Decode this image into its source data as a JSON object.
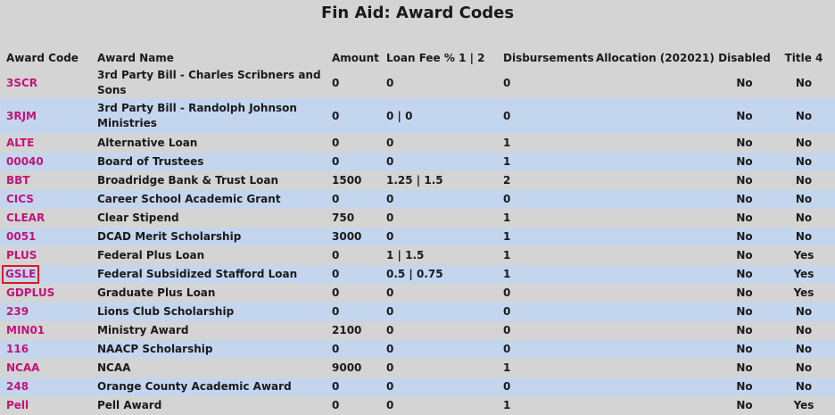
{
  "page": {
    "title": "Fin Aid: Award Codes"
  },
  "table": {
    "headers": [
      "Award Code",
      "Award Name",
      "Amount",
      "Loan Fee % 1 | 2",
      "Disbursements",
      "Allocation (202021)",
      "Disabled",
      "Title 4"
    ],
    "rows": [
      {
        "code": "3SCR",
        "name": "3rd Party Bill - Charles Scribners and Sons",
        "amount": "0",
        "fee": "0",
        "disb": "0",
        "alloc": "",
        "disabled": "No",
        "title4": "No"
      },
      {
        "code": "3RJM",
        "name": "3rd Party Bill - Randolph Johnson Ministries",
        "amount": "0",
        "fee": "0 | 0",
        "disb": "0",
        "alloc": "",
        "disabled": "No",
        "title4": "No"
      },
      {
        "code": "ALTE",
        "name": "Alternative Loan",
        "amount": "0",
        "fee": "0",
        "disb": "1",
        "alloc": "",
        "disabled": "No",
        "title4": "No"
      },
      {
        "code": "00040",
        "name": "Board of Trustees",
        "amount": "0",
        "fee": "0",
        "disb": "1",
        "alloc": "",
        "disabled": "No",
        "title4": "No"
      },
      {
        "code": "BBT",
        "name": "Broadridge Bank & Trust Loan",
        "amount": "1500",
        "fee": "1.25 | 1.5",
        "disb": "2",
        "alloc": "",
        "disabled": "No",
        "title4": "No"
      },
      {
        "code": "CICS",
        "name": "Career School Academic Grant",
        "amount": "0",
        "fee": "0",
        "disb": "0",
        "alloc": "",
        "disabled": "No",
        "title4": "No"
      },
      {
        "code": "CLEAR",
        "name": "Clear Stipend",
        "amount": "750",
        "fee": "0",
        "disb": "1",
        "alloc": "",
        "disabled": "No",
        "title4": "No"
      },
      {
        "code": "0051",
        "name": "DCAD Merit Scholarship",
        "amount": "3000",
        "fee": "0",
        "disb": "1",
        "alloc": "",
        "disabled": "No",
        "title4": "No"
      },
      {
        "code": "PLUS",
        "name": "Federal Plus Loan",
        "amount": "0",
        "fee": "1 | 1.5",
        "disb": "1",
        "alloc": "",
        "disabled": "No",
        "title4": "Yes"
      },
      {
        "code": "GSLE",
        "name": "Federal Subsidized Stafford Loan",
        "amount": "0",
        "fee": "0.5 | 0.75",
        "disb": "1",
        "alloc": "",
        "disabled": "No",
        "title4": "Yes",
        "selected": true
      },
      {
        "code": "GDPLUS",
        "name": "Graduate Plus Loan",
        "amount": "0",
        "fee": "0",
        "disb": "0",
        "alloc": "",
        "disabled": "No",
        "title4": "Yes"
      },
      {
        "code": "239",
        "name": "Lions Club Scholarship",
        "amount": "0",
        "fee": "0",
        "disb": "0",
        "alloc": "",
        "disabled": "No",
        "title4": "No"
      },
      {
        "code": "MIN01",
        "name": "Ministry Award",
        "amount": "2100",
        "fee": "0",
        "disb": "0",
        "alloc": "",
        "disabled": "No",
        "title4": "No"
      },
      {
        "code": "116",
        "name": "NAACP Scholarship",
        "amount": "0",
        "fee": "0",
        "disb": "0",
        "alloc": "",
        "disabled": "No",
        "title4": "No"
      },
      {
        "code": "NCAA",
        "name": "NCAA",
        "amount": "9000",
        "fee": "0",
        "disb": "1",
        "alloc": "",
        "disabled": "No",
        "title4": "No"
      },
      {
        "code": "248",
        "name": "Orange County Academic Award",
        "amount": "0",
        "fee": "0",
        "disb": "0",
        "alloc": "",
        "disabled": "No",
        "title4": "No"
      },
      {
        "code": "Pell",
        "name": "Pell Award",
        "amount": "0",
        "fee": "0",
        "disb": "1",
        "alloc": "",
        "disabled": "No",
        "title4": "Yes"
      }
    ]
  },
  "colors": {
    "link": "#c0147a",
    "row_alt": "#c4d6ee",
    "background": "#d4d4d4",
    "selection_outline": "#e01818"
  }
}
